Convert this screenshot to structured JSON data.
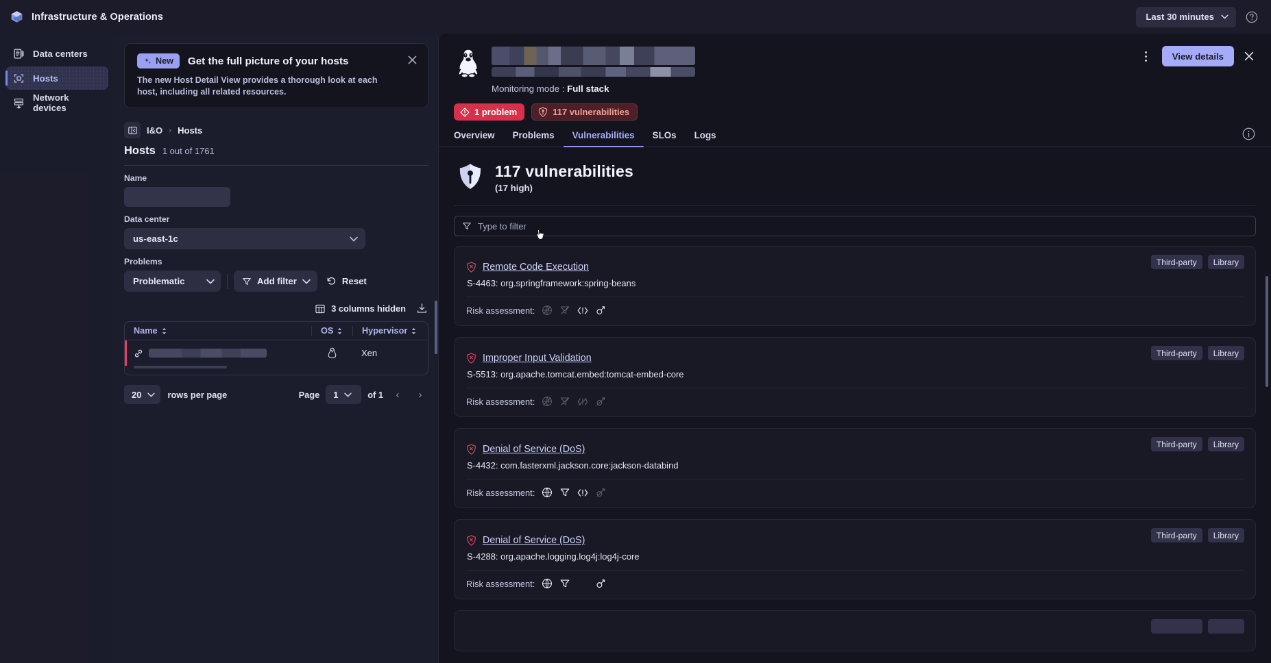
{
  "topbar": {
    "brand_title": "Infrastructure & Operations",
    "brand_icon": "cube-logo-icon",
    "timeframe_label": "Last 30 minutes",
    "help_icon": "question-circle-icon"
  },
  "sidebar": {
    "items": [
      {
        "label": "Data centers",
        "icon": "data-center-icon",
        "active": false
      },
      {
        "label": "Hosts",
        "icon": "host-icon",
        "active": true
      },
      {
        "label": "Network devices",
        "icon": "network-device-icon",
        "active": false
      }
    ]
  },
  "banner": {
    "badge": "New",
    "badge_icon": "sparkles-icon",
    "title": "Get the full picture of your hosts",
    "body": "The new Host Detail View provides a thorough look at each host, including all related resources.",
    "close_icon": "close-icon"
  },
  "breadcrumb": {
    "toggle_icon": "panel-collapse-icon",
    "root": "I&O",
    "separator": "›",
    "current": "Hosts"
  },
  "page": {
    "title": "Hosts",
    "count": "1 out of 1761"
  },
  "filters": {
    "name_label": "Name",
    "name_value": "",
    "name_placeholder": "",
    "datacenter_label": "Data center",
    "datacenter_value": "us-east-1c",
    "problems_label": "Problems",
    "problems_value": "Problematic",
    "add_filter_label": "Add filter",
    "add_filter_icon": "filter-icon",
    "reset_label": "Reset",
    "reset_icon": "undo-icon"
  },
  "table_tools": {
    "columns_hidden_label": "3 columns hidden",
    "columns_icon": "columns-icon",
    "download_icon": "download-icon"
  },
  "table": {
    "columns": [
      "Name",
      "OS",
      "Hypervisor"
    ],
    "sort_icon": "sort-icon",
    "rows": [
      {
        "name": "",
        "name_redacted": true,
        "link_icon": "link-icon",
        "os_icon": "linux-penguin-icon",
        "hypervisor": "Xen",
        "status": "critical"
      }
    ]
  },
  "pagination": {
    "rows_per_page_value": "20",
    "rows_per_page_label": "rows per page",
    "page_label": "Page",
    "page_value": "1",
    "of_label": "of 1",
    "prev_icon": "chevron-left-icon",
    "next_icon": "chevron-right-icon"
  },
  "detail": {
    "host_icon": "linux-penguin-icon",
    "title_redacted": true,
    "monitoring_mode_label": "Monitoring mode :",
    "monitoring_mode_value": "Full stack",
    "kebab_icon": "more-options-icon",
    "view_details_label": "View details",
    "close_icon": "close-icon",
    "info_icon": "info-circle-icon",
    "chips": [
      {
        "label": "1 problem",
        "icon": "problem-diamond-icon",
        "style": "problem"
      },
      {
        "label": "117 vulnerabilities",
        "icon": "vulnerability-shield-icon",
        "style": "vuln"
      }
    ],
    "tabs": [
      {
        "label": "Overview",
        "active": false
      },
      {
        "label": "Problems",
        "active": false
      },
      {
        "label": "Vulnerabilities",
        "active": true
      },
      {
        "label": "SLOs",
        "active": false
      },
      {
        "label": "Logs",
        "active": false
      }
    ]
  },
  "vulnerabilities": {
    "shield_icon": "vulnerability-shield-icon",
    "count_title": "117 vulnerabilities",
    "severity_sub": "(17 high)",
    "filter_icon": "filter-icon",
    "filter_value": "",
    "filter_placeholder": "Type to filter",
    "risk_label": "Risk assessment:",
    "cards": [
      {
        "tags": [
          "Third-party",
          "Library"
        ],
        "severity_icon": "critical-shield-icon",
        "title": "Remote Code Execution",
        "component": "S-4463: org.springframework:spring-beans",
        "risk_icons": [
          {
            "name": "internet-exposure-icon",
            "active": false
          },
          {
            "name": "data-asset-icon",
            "active": false
          },
          {
            "name": "public-exploit-icon",
            "active": true
          },
          {
            "name": "vulnerable-function-icon",
            "active": true
          }
        ]
      },
      {
        "tags": [
          "Third-party",
          "Library"
        ],
        "severity_icon": "critical-shield-icon",
        "title": "Improper Input Validation",
        "component": "S-5513: org.apache.tomcat.embed:tomcat-embed-core",
        "risk_icons": [
          {
            "name": "internet-exposure-icon",
            "active": false
          },
          {
            "name": "data-asset-icon",
            "active": false
          },
          {
            "name": "public-exploit-icon",
            "active": false
          },
          {
            "name": "vulnerable-function-icon",
            "active": false
          }
        ]
      },
      {
        "tags": [
          "Third-party",
          "Library"
        ],
        "severity_icon": "critical-shield-icon",
        "title": "Denial of Service (DoS)",
        "component": "S-4432: com.fasterxml.jackson.core:jackson-databind",
        "risk_icons": [
          {
            "name": "internet-exposure-icon",
            "active": true
          },
          {
            "name": "data-asset-icon",
            "active": true
          },
          {
            "name": "public-exploit-icon",
            "active": true
          },
          {
            "name": "vulnerable-function-icon",
            "active": false
          }
        ]
      },
      {
        "tags": [
          "Third-party",
          "Library"
        ],
        "severity_icon": "critical-shield-icon",
        "title": "Denial of Service (DoS)",
        "component": "S-4288: org.apache.logging.log4j:log4j-core",
        "risk_icons": [
          {
            "name": "internet-exposure-icon",
            "active": true
          },
          {
            "name": "data-asset-icon",
            "active": true
          },
          {
            "name": "public-exploit-icon",
            "active": false,
            "hidden": true
          },
          {
            "name": "vulnerable-function-icon",
            "active": true
          }
        ]
      }
    ]
  },
  "colors": {
    "accent": "#a5abf7",
    "critical": "#d6304a",
    "vuln_chip_bg": "#4d2029",
    "vuln_chip_text": "#f3a08e",
    "page_bg": "#14141f",
    "panel_bg": "#1c1d2c"
  }
}
